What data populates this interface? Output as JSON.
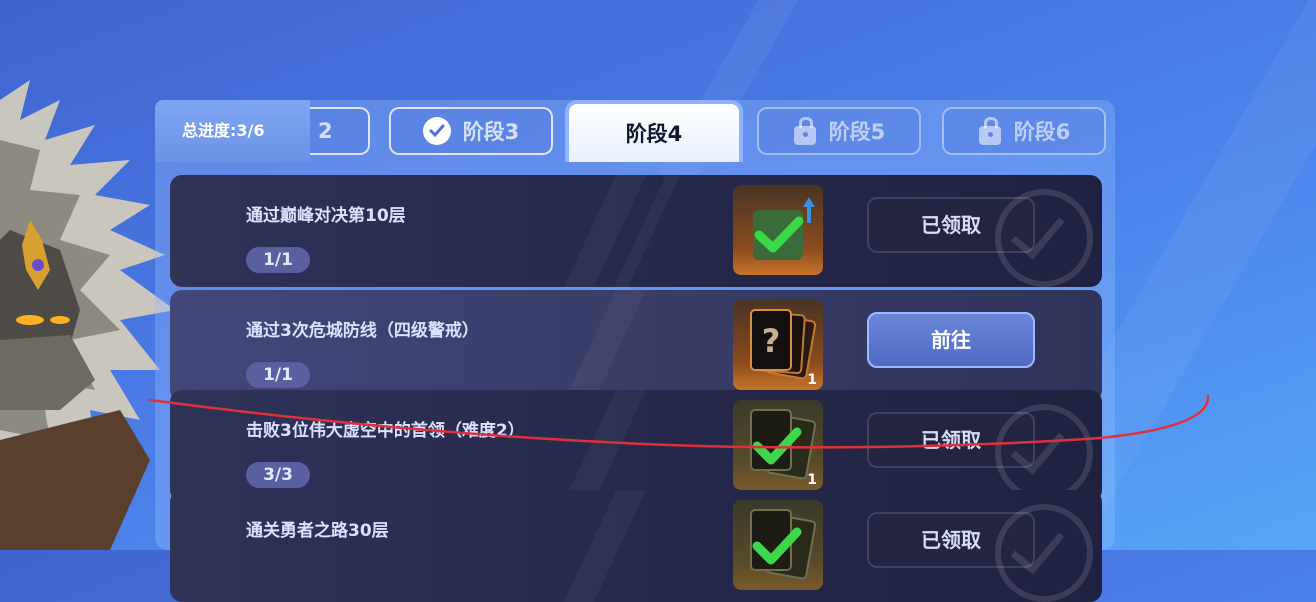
{
  "colors": {
    "background": "#4a7be6",
    "panel": "#2e3156",
    "accent": "#8fb3ff",
    "check_green": "#3cd84a",
    "annotation": "#e0303a"
  },
  "progress": {
    "label": "总进度:3/6"
  },
  "tabs": [
    {
      "label": "2",
      "state": "done-partial"
    },
    {
      "label": "阶段3",
      "state": "done",
      "icon": "check-icon"
    },
    {
      "label": "阶段4",
      "state": "active"
    },
    {
      "label": "阶段5",
      "state": "locked",
      "icon": "lock-icon"
    },
    {
      "label": "阶段6",
      "state": "locked",
      "icon": "lock-icon"
    }
  ],
  "tasks": [
    {
      "title": "通过巅峰对决第10层",
      "progress": "1/1",
      "reward": "claimed-check-icon",
      "reward_count": "",
      "button": "已领取",
      "status": "claimed"
    },
    {
      "title": "通过3次危城防线（四级警戒）",
      "progress": "1/1",
      "reward": "mystery-card-icon",
      "reward_count": "1",
      "button": "前往",
      "status": "available"
    },
    {
      "title": "击败3位伟大虚空中的首领（难度2）",
      "progress": "3/3",
      "reward": "claimed-check-icon",
      "reward_count": "1",
      "button": "已领取",
      "status": "claimed"
    },
    {
      "title": "通关勇者之路30层",
      "progress": "",
      "reward": "claimed-check-icon",
      "reward_count": "",
      "button": "已领取",
      "status": "claimed"
    }
  ]
}
